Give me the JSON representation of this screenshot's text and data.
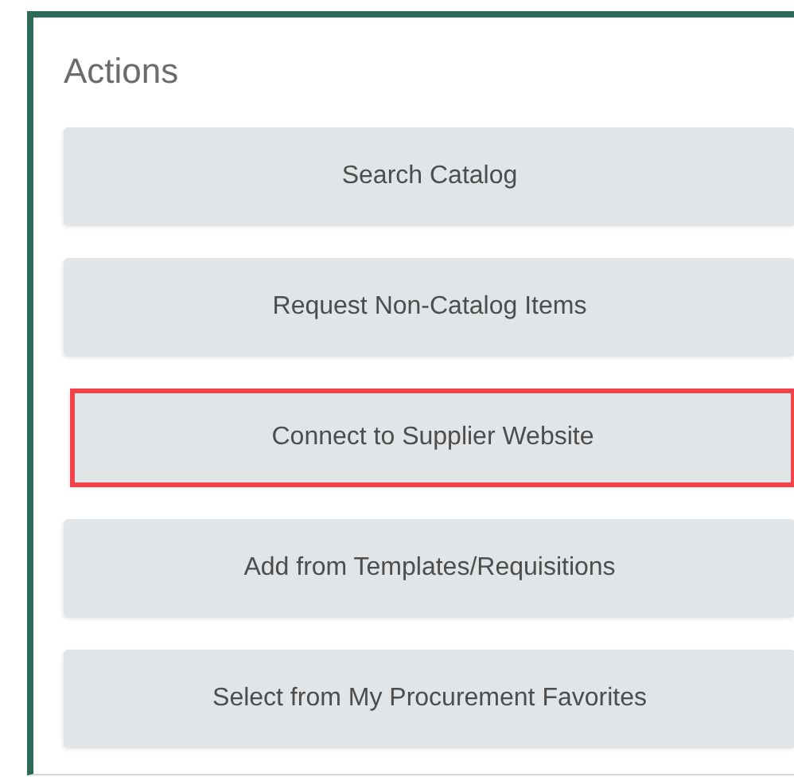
{
  "panel": {
    "title": "Actions",
    "buttons": [
      {
        "label": "Search Catalog",
        "highlighted": false
      },
      {
        "label": "Request Non-Catalog Items",
        "highlighted": false
      },
      {
        "label": "Connect to Supplier Website",
        "highlighted": true
      },
      {
        "label": "Add from Templates/Requisitions",
        "highlighted": false
      },
      {
        "label": "Select from My Procurement Favorites",
        "highlighted": false
      }
    ]
  }
}
